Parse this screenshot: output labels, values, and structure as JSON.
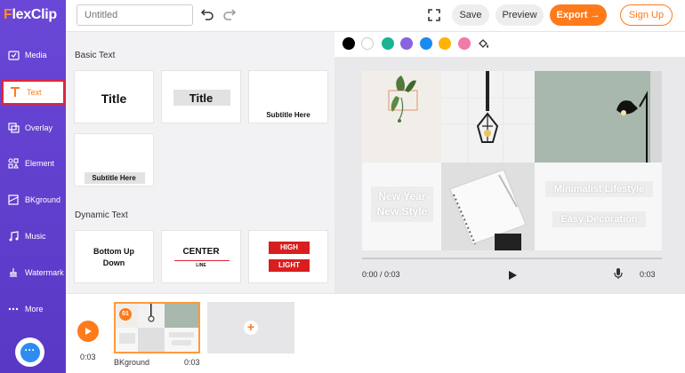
{
  "brand": {
    "logo_text_f": "F",
    "logo_text_rest": "lexClip"
  },
  "sidebar": {
    "items": [
      {
        "label": "Media",
        "icon": "media-icon"
      },
      {
        "label": "Text",
        "icon": "text-icon",
        "active": true
      },
      {
        "label": "Overlay",
        "icon": "overlay-icon"
      },
      {
        "label": "Element",
        "icon": "element-icon"
      },
      {
        "label": "BKground",
        "icon": "background-icon"
      },
      {
        "label": "Music",
        "icon": "music-icon"
      },
      {
        "label": "Watermark",
        "icon": "watermark-icon"
      },
      {
        "label": "More",
        "icon": "more-icon"
      }
    ],
    "chat_icon": "chat-icon"
  },
  "topbar": {
    "title_placeholder": "Untitled",
    "save_label": "Save",
    "preview_label": "Preview",
    "export_label": "Export →",
    "signup_label": "Sign Up"
  },
  "panel": {
    "basic_text_heading": "Basic Text",
    "dynamic_text_heading": "Dynamic Text",
    "basic_cards": [
      {
        "text": "Title"
      },
      {
        "text": "Title"
      },
      {
        "text": "Subtitle Here"
      },
      {
        "text": "Subtitle Here"
      }
    ],
    "dynamic_cards": [
      {
        "line1": "Bottom Up",
        "line2": "Down"
      },
      {
        "line1": "CENTER",
        "line2": "LINE"
      },
      {
        "line1": "HIGH",
        "line2": "LIGHT"
      }
    ]
  },
  "palette": {
    "colors": [
      "#000000",
      "#ffffff",
      "#1ab394",
      "#8a63e0",
      "#1a8cf0",
      "#ffb400",
      "#f07aa8"
    ]
  },
  "canvas": {
    "text1_line1": "New Year",
    "text1_line2": "New Style",
    "text2": "Minimalist Lifestyle",
    "text3": "Easy Decoration"
  },
  "player": {
    "current_time": "0:00 / 0:03",
    "duration": "0:03"
  },
  "timeline": {
    "time": "0:03",
    "clip_badge": "01",
    "clip_label": "BKground",
    "clip_duration": "0:03"
  }
}
